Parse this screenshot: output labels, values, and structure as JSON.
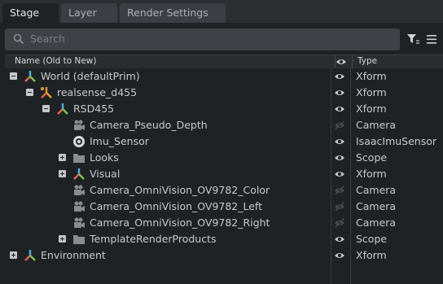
{
  "tabs": [
    {
      "label": "Stage",
      "active": true
    },
    {
      "label": "Layer",
      "active": false
    },
    {
      "label": "Render Settings",
      "active": false
    }
  ],
  "search": {
    "placeholder": "Search"
  },
  "columns": {
    "name": "Name (Old to New)",
    "type": "Type"
  },
  "tree": [
    {
      "label": "World (defaultPrim)",
      "type": "Xform",
      "depth": 0,
      "expander": "minus",
      "icon": "xform-icon",
      "visible": true
    },
    {
      "label": "realsense_d455",
      "type": "Xform",
      "depth": 1,
      "expander": "minus",
      "icon": "xform-reference-icon",
      "visible": true
    },
    {
      "label": "RSD455",
      "type": "Xform",
      "depth": 2,
      "expander": "minus",
      "icon": "xform-icon",
      "visible": true
    },
    {
      "label": "Camera_Pseudo_Depth",
      "type": "Camera",
      "depth": 3,
      "expander": "none",
      "icon": "camera-icon",
      "visible": false
    },
    {
      "label": "Imu_Sensor",
      "type": "IsaacImuSensor",
      "depth": 3,
      "expander": "none",
      "icon": "sensor-icon",
      "visible": true
    },
    {
      "label": "Looks",
      "type": "Scope",
      "depth": 3,
      "expander": "plus",
      "icon": "folder-icon",
      "visible": true
    },
    {
      "label": "Visual",
      "type": "Xform",
      "depth": 3,
      "expander": "plus",
      "icon": "xform-icon",
      "visible": true
    },
    {
      "label": "Camera_OmniVision_OV9782_Color",
      "type": "Camera",
      "depth": 3,
      "expander": "none",
      "icon": "camera-icon",
      "visible": false
    },
    {
      "label": "Camera_OmniVision_OV9782_Left",
      "type": "Camera",
      "depth": 3,
      "expander": "none",
      "icon": "camera-icon",
      "visible": false
    },
    {
      "label": "Camera_OmniVision_OV9782_Right",
      "type": "Camera",
      "depth": 3,
      "expander": "none",
      "icon": "camera-icon",
      "visible": false
    },
    {
      "label": "TemplateRenderProducts",
      "type": "Scope",
      "depth": 3,
      "expander": "plus",
      "icon": "folder-icon",
      "visible": true
    },
    {
      "label": "Environment",
      "type": "Xform",
      "depth": 0,
      "expander": "plus",
      "icon": "xform-icon",
      "visible": true
    }
  ]
}
